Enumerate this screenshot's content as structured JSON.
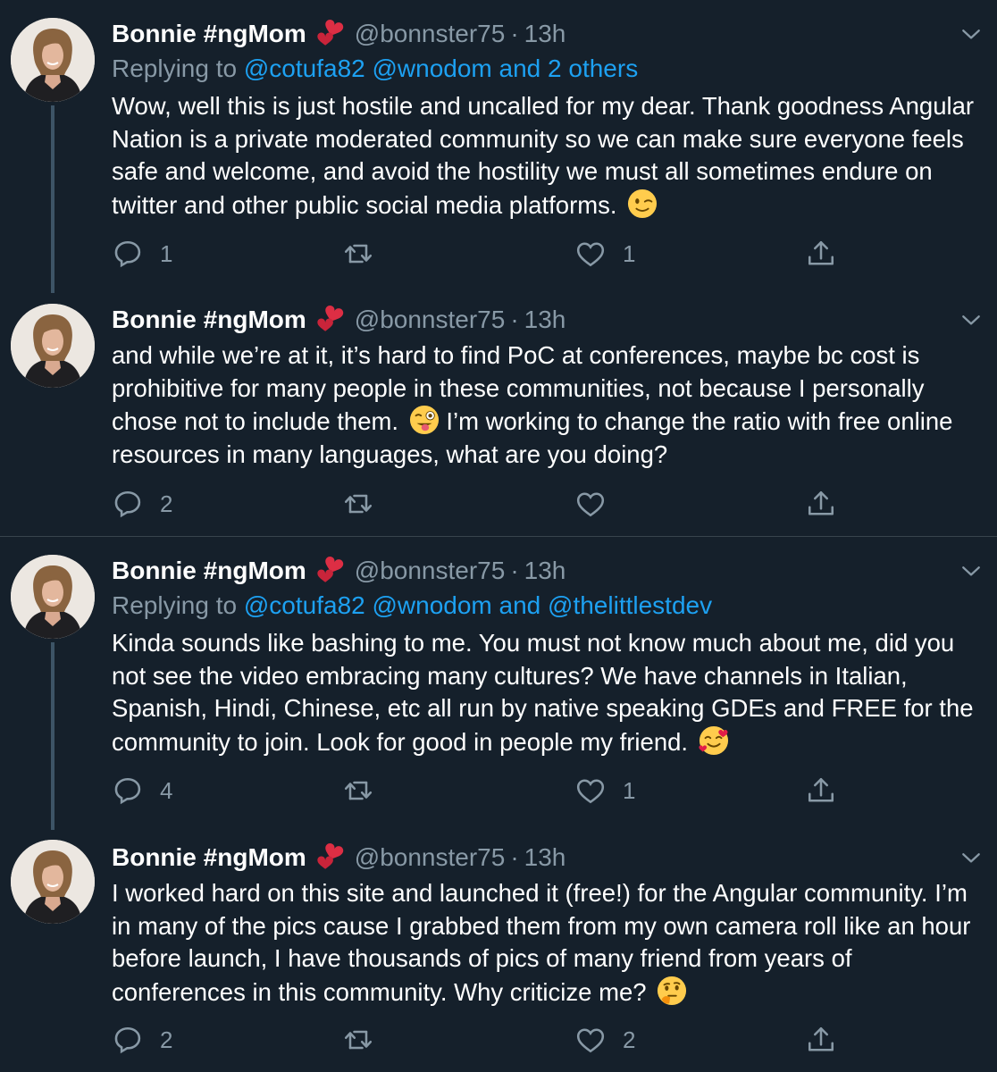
{
  "tweets": [
    {
      "name": "Bonnie #ngMom",
      "handle": "@bonnster75",
      "dot": "·",
      "time": "13h",
      "replying": {
        "prefix": "Replying to ",
        "mentions": "@cotufa82 @wnodom and 2 others"
      },
      "text": "Wow, well this is just hostile and uncalled for my dear. Thank goodness Angular Nation is a private moderated community so we can make sure everyone feels safe and welcome, and avoid the hostility we must all sometimes endure on twitter and other public social media platforms.",
      "emoji": "winking-face",
      "replies": "1",
      "retweets": "",
      "likes": "1"
    },
    {
      "name": "Bonnie #ngMom",
      "handle": "@bonnster75",
      "dot": "·",
      "time": "13h",
      "text_before": "and while we’re at it, it’s hard to find PoC at conferences, maybe bc cost is prohibitive for many people in these communities, not because I personally chose not to include them.",
      "text_after": "I’m working to change the ratio with free online resources in many languages, what are you doing?",
      "emoji": "winking-face-with-tongue",
      "replies": "2",
      "retweets": "",
      "likes": ""
    },
    {
      "name": "Bonnie #ngMom",
      "handle": "@bonnster75",
      "dot": "·",
      "time": "13h",
      "replying": {
        "prefix": "Replying to ",
        "mentions": "@cotufa82 @wnodom and @thelittlestdev"
      },
      "text": "Kinda sounds like bashing to me. You must not know much about me, did you not see the video embracing many cultures? We have channels in Italian, Spanish, Hindi, Chinese, etc all run by native speaking GDEs and FREE for the community to join. Look for good in people my friend.",
      "emoji": "smiling-face-with-hearts",
      "replies": "4",
      "retweets": "",
      "likes": "1"
    },
    {
      "name": "Bonnie #ngMom",
      "handle": "@bonnster75",
      "dot": "·",
      "time": "13h",
      "text": "I worked hard on this site and launched it (free!) for the Angular community. I’m in many of the pics cause I grabbed them from my own camera roll like an hour before launch, I have thousands of pics of many friend from years of conferences in this community. Why criticize me?",
      "emoji": "thinking-face",
      "replies": "2",
      "retweets": "",
      "likes": "2"
    }
  ],
  "colors": {
    "background": "#15202b",
    "secondary_text": "#8899a6",
    "link": "#1da1f2",
    "thread_line": "#3d5466",
    "divider": "#38444d"
  }
}
